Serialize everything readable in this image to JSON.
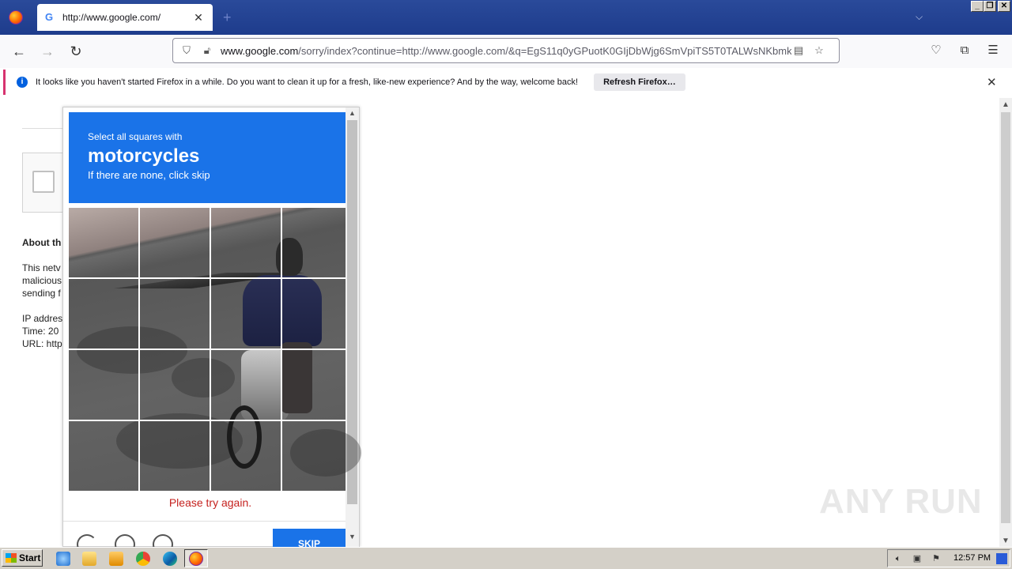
{
  "browser": {
    "tab_title": "http://www.google.com/",
    "url_host": "www.google.com",
    "url_rest": "/sorry/index?continue=http://www.google.com/&q=EgS11q0yGPuotK0GIjDbWjg6SmVpiTS5T0TALWsNKbmkx",
    "notification": {
      "message": "It looks like you haven't started Firefox in a while. Do you want to clean it up for a fresh, like-new experience? And by the way, welcome back!",
      "button": "Refresh Firefox…"
    }
  },
  "page": {
    "about_heading": "About th",
    "lines": [
      "This netv",
      "malicious",
      "sending f",
      "IP addres",
      "Time: 20",
      "URL: http"
    ]
  },
  "challenge": {
    "instruction": "Select all squares with",
    "target": "motorcycles",
    "hint": "If there are none, click skip",
    "error": "Please try again.",
    "skip_label": "SKIP"
  },
  "watermark": "ANY RUN",
  "taskbar": {
    "start_label": "Start",
    "clock": "12:57 PM"
  }
}
